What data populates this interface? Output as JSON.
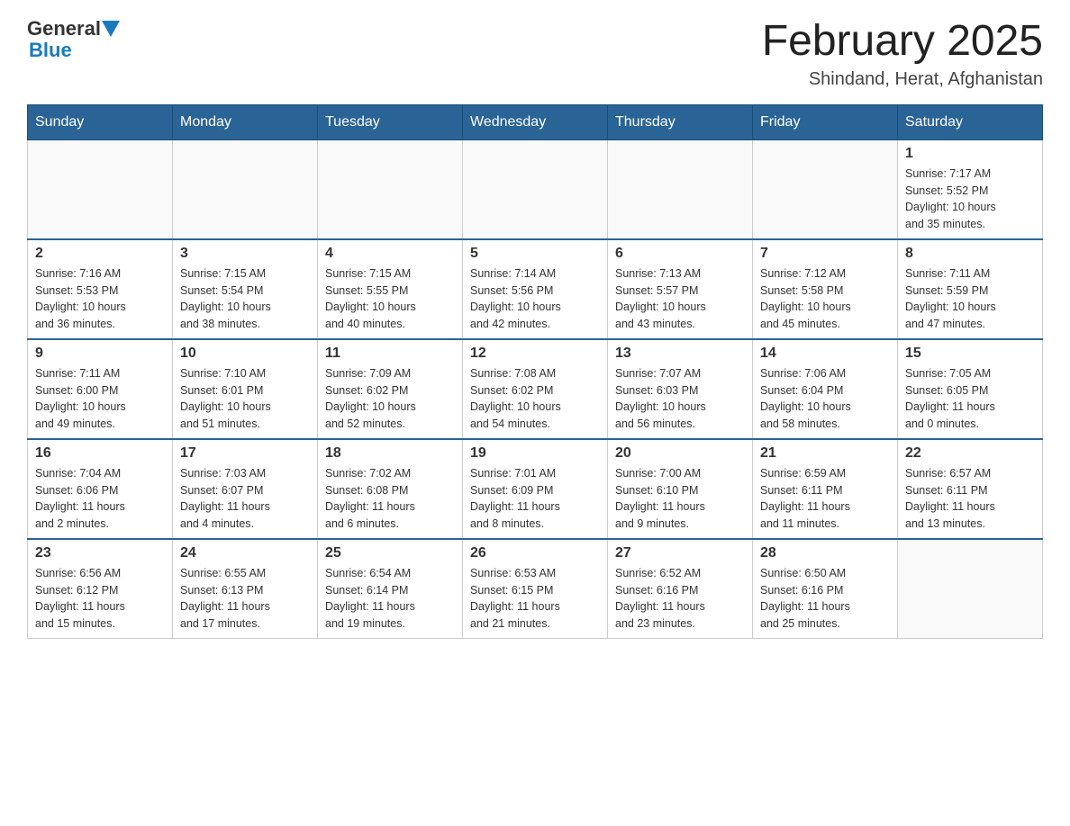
{
  "header": {
    "logo_general": "General",
    "logo_blue": "Blue",
    "month_title": "February 2025",
    "location": "Shindand, Herat, Afghanistan"
  },
  "calendar": {
    "days_of_week": [
      "Sunday",
      "Monday",
      "Tuesday",
      "Wednesday",
      "Thursday",
      "Friday",
      "Saturday"
    ],
    "weeks": [
      [
        {
          "day": "",
          "info": ""
        },
        {
          "day": "",
          "info": ""
        },
        {
          "day": "",
          "info": ""
        },
        {
          "day": "",
          "info": ""
        },
        {
          "day": "",
          "info": ""
        },
        {
          "day": "",
          "info": ""
        },
        {
          "day": "1",
          "info": "Sunrise: 7:17 AM\nSunset: 5:52 PM\nDaylight: 10 hours\nand 35 minutes."
        }
      ],
      [
        {
          "day": "2",
          "info": "Sunrise: 7:16 AM\nSunset: 5:53 PM\nDaylight: 10 hours\nand 36 minutes."
        },
        {
          "day": "3",
          "info": "Sunrise: 7:15 AM\nSunset: 5:54 PM\nDaylight: 10 hours\nand 38 minutes."
        },
        {
          "day": "4",
          "info": "Sunrise: 7:15 AM\nSunset: 5:55 PM\nDaylight: 10 hours\nand 40 minutes."
        },
        {
          "day": "5",
          "info": "Sunrise: 7:14 AM\nSunset: 5:56 PM\nDaylight: 10 hours\nand 42 minutes."
        },
        {
          "day": "6",
          "info": "Sunrise: 7:13 AM\nSunset: 5:57 PM\nDaylight: 10 hours\nand 43 minutes."
        },
        {
          "day": "7",
          "info": "Sunrise: 7:12 AM\nSunset: 5:58 PM\nDaylight: 10 hours\nand 45 minutes."
        },
        {
          "day": "8",
          "info": "Sunrise: 7:11 AM\nSunset: 5:59 PM\nDaylight: 10 hours\nand 47 minutes."
        }
      ],
      [
        {
          "day": "9",
          "info": "Sunrise: 7:11 AM\nSunset: 6:00 PM\nDaylight: 10 hours\nand 49 minutes."
        },
        {
          "day": "10",
          "info": "Sunrise: 7:10 AM\nSunset: 6:01 PM\nDaylight: 10 hours\nand 51 minutes."
        },
        {
          "day": "11",
          "info": "Sunrise: 7:09 AM\nSunset: 6:02 PM\nDaylight: 10 hours\nand 52 minutes."
        },
        {
          "day": "12",
          "info": "Sunrise: 7:08 AM\nSunset: 6:02 PM\nDaylight: 10 hours\nand 54 minutes."
        },
        {
          "day": "13",
          "info": "Sunrise: 7:07 AM\nSunset: 6:03 PM\nDaylight: 10 hours\nand 56 minutes."
        },
        {
          "day": "14",
          "info": "Sunrise: 7:06 AM\nSunset: 6:04 PM\nDaylight: 10 hours\nand 58 minutes."
        },
        {
          "day": "15",
          "info": "Sunrise: 7:05 AM\nSunset: 6:05 PM\nDaylight: 11 hours\nand 0 minutes."
        }
      ],
      [
        {
          "day": "16",
          "info": "Sunrise: 7:04 AM\nSunset: 6:06 PM\nDaylight: 11 hours\nand 2 minutes."
        },
        {
          "day": "17",
          "info": "Sunrise: 7:03 AM\nSunset: 6:07 PM\nDaylight: 11 hours\nand 4 minutes."
        },
        {
          "day": "18",
          "info": "Sunrise: 7:02 AM\nSunset: 6:08 PM\nDaylight: 11 hours\nand 6 minutes."
        },
        {
          "day": "19",
          "info": "Sunrise: 7:01 AM\nSunset: 6:09 PM\nDaylight: 11 hours\nand 8 minutes."
        },
        {
          "day": "20",
          "info": "Sunrise: 7:00 AM\nSunset: 6:10 PM\nDaylight: 11 hours\nand 9 minutes."
        },
        {
          "day": "21",
          "info": "Sunrise: 6:59 AM\nSunset: 6:11 PM\nDaylight: 11 hours\nand 11 minutes."
        },
        {
          "day": "22",
          "info": "Sunrise: 6:57 AM\nSunset: 6:11 PM\nDaylight: 11 hours\nand 13 minutes."
        }
      ],
      [
        {
          "day": "23",
          "info": "Sunrise: 6:56 AM\nSunset: 6:12 PM\nDaylight: 11 hours\nand 15 minutes."
        },
        {
          "day": "24",
          "info": "Sunrise: 6:55 AM\nSunset: 6:13 PM\nDaylight: 11 hours\nand 17 minutes."
        },
        {
          "day": "25",
          "info": "Sunrise: 6:54 AM\nSunset: 6:14 PM\nDaylight: 11 hours\nand 19 minutes."
        },
        {
          "day": "26",
          "info": "Sunrise: 6:53 AM\nSunset: 6:15 PM\nDaylight: 11 hours\nand 21 minutes."
        },
        {
          "day": "27",
          "info": "Sunrise: 6:52 AM\nSunset: 6:16 PM\nDaylight: 11 hours\nand 23 minutes."
        },
        {
          "day": "28",
          "info": "Sunrise: 6:50 AM\nSunset: 6:16 PM\nDaylight: 11 hours\nand 25 minutes."
        },
        {
          "day": "",
          "info": ""
        }
      ]
    ]
  }
}
